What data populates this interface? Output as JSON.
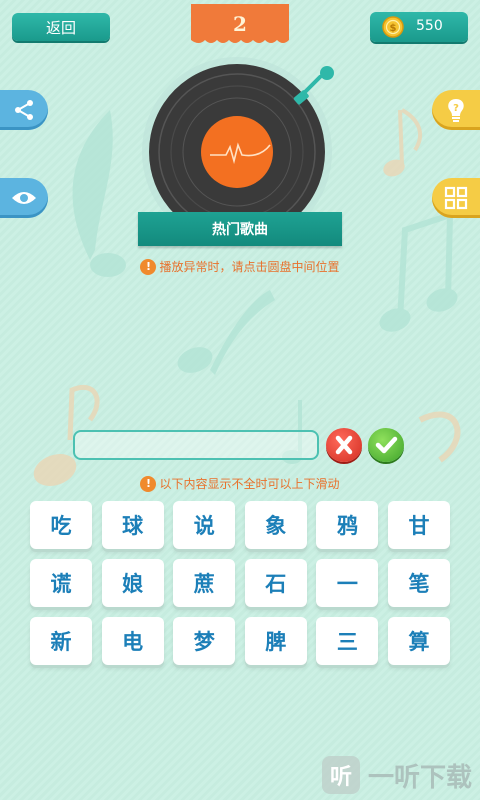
{
  "header": {
    "back_label": "返回",
    "level": "2",
    "coins": "550"
  },
  "side": {
    "left": [
      {
        "icon": "share-icon"
      },
      {
        "icon": "eye-icon"
      }
    ],
    "right": [
      {
        "icon": "hint-bulb-icon"
      },
      {
        "icon": "grid-icon"
      }
    ]
  },
  "record": {
    "category": "热门歌曲"
  },
  "hints": {
    "playback": "播放异常时，请点击圆盘中间位置",
    "scroll": "以下内容显示不全时可以上下滑动"
  },
  "answer": {
    "value": ""
  },
  "chars": [
    "吃",
    "球",
    "说",
    "象",
    "鸦",
    "甘",
    "谎",
    "娘",
    "蔗",
    "石",
    "一",
    "笔",
    "新",
    "电",
    "梦",
    "脾",
    "三",
    "算"
  ],
  "watermark": {
    "icon": "听",
    "text": "一听下载"
  },
  "colors": {
    "accent_teal": "#1a9a8c",
    "level_orange": "#f07a3a",
    "hint_orange": "#e8712c",
    "char_blue": "#1c7fb8",
    "side_blue": "#5cb4e0",
    "side_yellow": "#f5cc45"
  }
}
